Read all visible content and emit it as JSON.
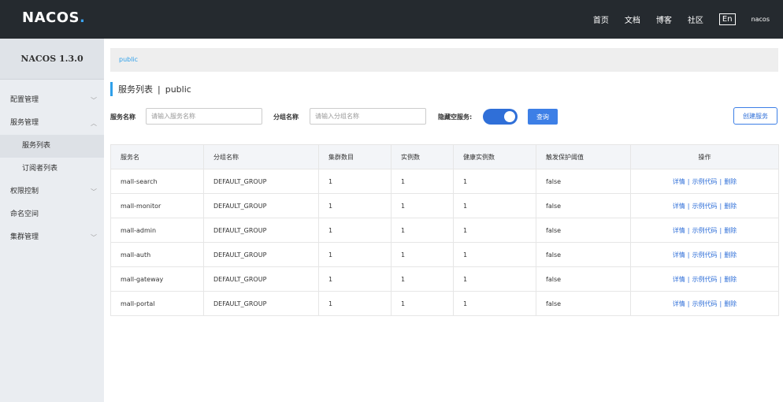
{
  "header": {
    "logo": "NACOS",
    "logo_dot": ".",
    "nav": [
      "首页",
      "文档",
      "博客",
      "社区"
    ],
    "lang": "En",
    "user": "nacos"
  },
  "sidebar": {
    "version": "NACOS 1.3.0",
    "items": [
      {
        "label": "配置管理",
        "chevron": "﹀"
      },
      {
        "label": "服务管理",
        "chevron": "︿"
      },
      {
        "label": "服务列表"
      },
      {
        "label": "订阅者列表"
      },
      {
        "label": "权限控制",
        "chevron": "﹀"
      },
      {
        "label": "命名空间"
      },
      {
        "label": "集群管理",
        "chevron": "﹀"
      }
    ]
  },
  "namespace": "public",
  "page": {
    "title": "服务列表",
    "separator": "|",
    "namespace": "public"
  },
  "filters": {
    "service_label": "服务名称",
    "service_placeholder": "请输入服务名称",
    "group_label": "分组名称",
    "group_placeholder": "请输入分组名称",
    "hide_empty_label": "隐藏空服务:",
    "hide_empty_on": true,
    "query_button": "查询",
    "create_button": "创建服务"
  },
  "table": {
    "columns": [
      "服务名",
      "分组名称",
      "集群数目",
      "实例数",
      "健康实例数",
      "触发保护阈值",
      "操作"
    ],
    "ops": {
      "detail": "详情",
      "sample": "示例代码",
      "delete": "删除",
      "sep": "|"
    },
    "rows": [
      {
        "name": "mall-search",
        "group": "DEFAULT_GROUP",
        "clusters": "1",
        "instances": "1",
        "healthy": "1",
        "protect": "false"
      },
      {
        "name": "mall-monitor",
        "group": "DEFAULT_GROUP",
        "clusters": "1",
        "instances": "1",
        "healthy": "1",
        "protect": "false"
      },
      {
        "name": "mall-admin",
        "group": "DEFAULT_GROUP",
        "clusters": "1",
        "instances": "1",
        "healthy": "1",
        "protect": "false"
      },
      {
        "name": "mall-auth",
        "group": "DEFAULT_GROUP",
        "clusters": "1",
        "instances": "1",
        "healthy": "1",
        "protect": "false"
      },
      {
        "name": "mall-gateway",
        "group": "DEFAULT_GROUP",
        "clusters": "1",
        "instances": "1",
        "healthy": "1",
        "protect": "false"
      },
      {
        "name": "mall-portal",
        "group": "DEFAULT_GROUP",
        "clusters": "1",
        "instances": "1",
        "healthy": "1",
        "protect": "false"
      }
    ]
  },
  "colors": {
    "topbar": "#252a2f",
    "accent": "#2fa0ea",
    "primary": "#3d7fe6"
  }
}
